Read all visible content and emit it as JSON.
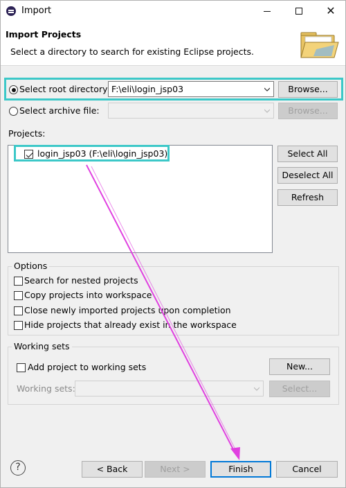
{
  "window": {
    "title": "Import",
    "icon": "eclipse-icon",
    "controls": {
      "minimize": "minimize-icon",
      "maximize": "maximize-icon",
      "close": "✕"
    }
  },
  "banner": {
    "title": "Import Projects",
    "description": "Select a directory to search for existing Eclipse projects.",
    "icon": "folder-icon"
  },
  "source": {
    "root_label": "Select root directory:",
    "root_value": "F:\\eli\\login_jsp03",
    "root_selected": true,
    "browse_label": "Browse...",
    "archive_label": "Select archive file:",
    "archive_value": "",
    "archive_browse_label": "Browse..."
  },
  "projects": {
    "label": "Projects:",
    "items": [
      {
        "name": "login_jsp03 (F:\\eli\\login_jsp03)",
        "checked": true
      }
    ],
    "select_all": "Select All",
    "deselect_all": "Deselect All",
    "refresh": "Refresh"
  },
  "options": {
    "title": "Options",
    "items": [
      {
        "label": "Search for nested projects",
        "checked": false
      },
      {
        "label": "Copy projects into workspace",
        "checked": false
      },
      {
        "label": "Close newly imported projects upon completion",
        "checked": false
      },
      {
        "label": "Hide projects that already exist in the workspace",
        "checked": false
      }
    ]
  },
  "working_sets": {
    "title": "Working sets",
    "add_label": "Add project to working sets",
    "add_checked": false,
    "new_label": "New...",
    "sets_label": "Working sets:",
    "sets_value": "",
    "select_label": "Select..."
  },
  "footer": {
    "help": "?",
    "back": "< Back",
    "next": "Next >",
    "finish": "Finish",
    "cancel": "Cancel"
  },
  "annotation": {
    "highlight_color": "#3cc8c8",
    "arrow_color": "#e040e0"
  }
}
